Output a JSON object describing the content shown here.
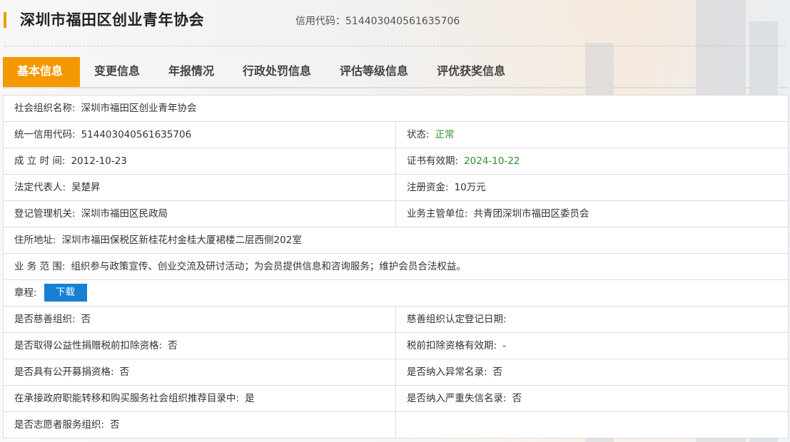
{
  "header": {
    "org_name": "深圳市福田区创业青年协会",
    "credit_label": "信用代码：",
    "credit_code": "514403040561635706"
  },
  "tabs": [
    {
      "label": "基本信息",
      "active": true
    },
    {
      "label": "变更信息"
    },
    {
      "label": "年报情况"
    },
    {
      "label": "行政处罚信息"
    },
    {
      "label": "评估等级信息"
    },
    {
      "label": "评优获奖信息"
    }
  ],
  "info": {
    "name_label": "社会组织名称:",
    "name": "深圳市福田区创业青年协会",
    "uscc_label": "统一信用代码:",
    "uscc": "514403040561635706",
    "status_label": "状态:",
    "status": "正常",
    "established_label": "成 立 时 间:",
    "established": "2012-10-23",
    "cert_valid_label": "证书有效期:",
    "cert_valid": "2024-10-22",
    "legal_rep_label": "法定代表人:",
    "legal_rep": "吴楚昇",
    "capital_label": "注册资金:",
    "capital": "10万元",
    "registrar_label": "登记管理机关:",
    "registrar": "深圳市福田区民政局",
    "supervisor_label": "业务主管单位:",
    "supervisor": "共青团深圳市福田区委员会",
    "address_label": "住所地址:",
    "address": "深圳市福田保税区新桂花村金桂大厦裙楼二层西侧202室",
    "scope_label": "业 务 范 围:",
    "scope": "组织参与政策宣传、创业交流及研讨活动；为会员提供信息和咨询服务；维护会员合法权益。",
    "charter_label": "章程:",
    "download_label": "下载",
    "charity_label": "是否慈善组织:",
    "charity": "否",
    "charity_date_label": "慈善组织认定登记日期:",
    "charity_date": "",
    "tax_deduct_label": "是否取得公益性捐赠税前扣除资格:",
    "tax_deduct": "否",
    "tax_valid_label": "税前扣除资格有效期:",
    "tax_valid": "-",
    "public_fund_label": "是否具有公开募捐资格:",
    "public_fund": "否",
    "abnormal_label": "是否纳入异常名录:",
    "abnormal": "否",
    "gov_service_label": "在承接政府职能转移和购买服务社会组织推荐目录中:",
    "gov_service": "是",
    "dishonest_label": "是否纳入严重失信名录:",
    "dishonest": "否",
    "volunteer_label": "是否志愿者服务组织:",
    "volunteer": "否"
  },
  "colors": {
    "accent": "#f39800",
    "status_green": "#2f8f2f",
    "button_blue": "#1780d4"
  }
}
